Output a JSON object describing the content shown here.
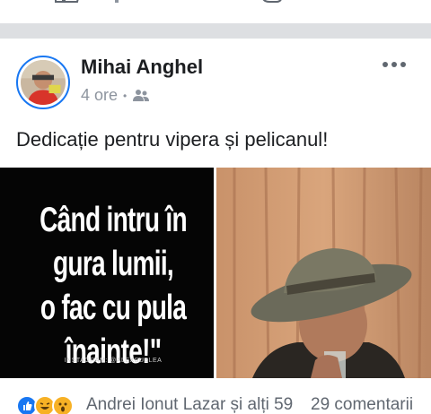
{
  "post": {
    "author": "Mihai Anghel",
    "time": "4 ore",
    "separator": "•",
    "audience_icon": "friends-icon",
    "text": "Dedicație pentru vipera și pelicanul!",
    "image_left": {
      "quote_lines": [
        "Când intru în",
        "gura lumii,",
        "o fac cu pula",
        "înainte!\""
      ],
      "credit": "INSTAGRAM: @ALEXSUBLEA"
    }
  },
  "reactions": {
    "icons": [
      "like-icon",
      "haha-icon",
      "wow-icon"
    ],
    "summary": "Andrei Ionut Lazar și alți 59",
    "comments": "29 comentarii"
  },
  "colors": {
    "brand": "#1877f2",
    "separator": "#dddfe2",
    "secondary_text": "#8d949e"
  }
}
